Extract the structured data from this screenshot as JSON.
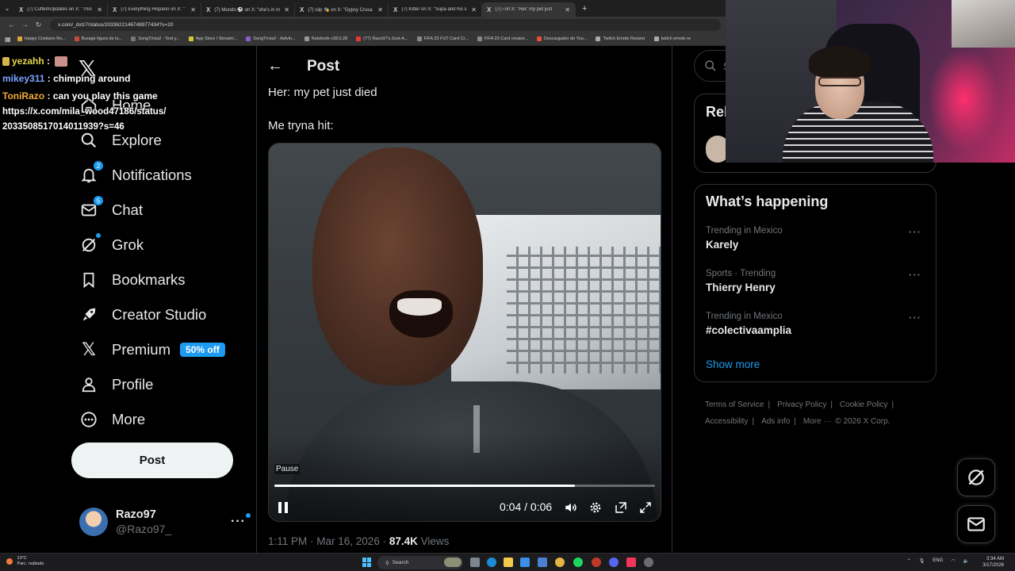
{
  "browser": {
    "tabs": [
      {
        "title": "(7) CuffemUpdates on X: \"This"
      },
      {
        "title": "(7) Everything Hispano on X: \""
      },
      {
        "title": "(7) Mundo ⚽ on X: \"she's in m"
      },
      {
        "title": "(7) clip 🎭 on X: \"Gypsy Crusa"
      },
      {
        "title": "(7) Kitter on X: \"Supa and his s"
      },
      {
        "title": "(7) i on X: \"Her: my pet just"
      }
    ],
    "active_tab": 5,
    "url": "x.com/_dxlz7/status/2033622146748977434?s=20",
    "bookmarks": [
      {
        "label": "Happy Cristiano Ro...",
        "color": "#d9a441"
      },
      {
        "label": "Burago figura de to...",
        "color": "#c74d3a"
      },
      {
        "label": "SongTrivia2 - Test y...",
        "color": "#777777"
      },
      {
        "label": "App Store / Streami...",
        "color": "#d7c83a"
      },
      {
        "label": "SongTrivia2 - Adivin...",
        "color": "#8a5bd1"
      },
      {
        "label": "Raletools v28.0.28",
        "color": "#999999"
      },
      {
        "label": "(77) Razo97's Zest-A...",
        "color": "#e53935"
      },
      {
        "label": "FIFA 23 FUT Card Cr...",
        "color": "#888888"
      },
      {
        "label": "FIFA 23 Card creator...",
        "color": "#888888"
      },
      {
        "label": "Descargador de You...",
        "color": "#e74c3c"
      },
      {
        "label": "Twitch Emote Resizer",
        "color": "#aaaaaa"
      },
      {
        "label": "twitch emote re",
        "color": "#aaaaaa"
      }
    ]
  },
  "chat": {
    "lines": [
      {
        "user": "yezahh",
        "text": ""
      },
      {
        "user": "mikey311",
        "text": "chimping around"
      },
      {
        "user": "ToniRazo",
        "text": "can you play this game"
      }
    ],
    "url_text": "https://x.com/mila_wood47186/status/2033508517014011939?s=46"
  },
  "nav": {
    "items": [
      {
        "label": "Home",
        "icon": "home-icon"
      },
      {
        "label": "Explore",
        "icon": "search-icon"
      },
      {
        "label": "Notifications",
        "icon": "bell-icon",
        "badge": "2"
      },
      {
        "label": "Chat",
        "icon": "mail-icon",
        "badge": "5"
      },
      {
        "label": "Grok",
        "icon": "grok-icon"
      },
      {
        "label": "Bookmarks",
        "icon": "bookmark-icon"
      },
      {
        "label": "Creator Studio",
        "icon": "rocket-icon"
      },
      {
        "label": "Premium",
        "icon": "x-logo-icon",
        "promo": "50% off"
      },
      {
        "label": "Profile",
        "icon": "person-icon"
      },
      {
        "label": "More",
        "icon": "more-circle-icon"
      }
    ],
    "post_button": "Post",
    "account": {
      "name": "Razo97",
      "handle": "@Razo97_"
    }
  },
  "post": {
    "header": "Post",
    "lines": [
      "Her: my pet just died",
      "Me tryna hit:"
    ],
    "video": {
      "tooltip": "Pause",
      "current": "0:04",
      "duration": "0:06",
      "time_label": "0:04 / 0:06",
      "progress": 0.79
    },
    "time": "1:11 PM · Mar 16, 2026 · ",
    "views": "87.4K",
    "views_label": " Views"
  },
  "sidebar": {
    "search_placeholder": "Search",
    "relevant_title": "Relevant people",
    "happening_title": "What’s happening",
    "trends": [
      {
        "context": "Trending in Mexico",
        "name": "Karely"
      },
      {
        "context": "Sports · Trending",
        "name": "Thierry Henry"
      },
      {
        "context": "Trending in Mexico",
        "name": "#colectivaamplia"
      }
    ],
    "show_more": "Show more",
    "footer": [
      "Terms of Service",
      "Privacy Policy",
      "Cookie Policy",
      "Accessibility",
      "Ads info",
      "More ···",
      "© 2026 X Corp."
    ]
  },
  "taskbar": {
    "weather_temp": "13°C",
    "weather_desc": "Parc. nublado",
    "search_label": "Search",
    "lang": "ENG",
    "time": "3:34 AM",
    "date": "3/17/2026"
  },
  "colors": {
    "accent": "#1d9bf0",
    "background": "#000000",
    "text": "#e7e9ea",
    "muted": "#71767b"
  }
}
